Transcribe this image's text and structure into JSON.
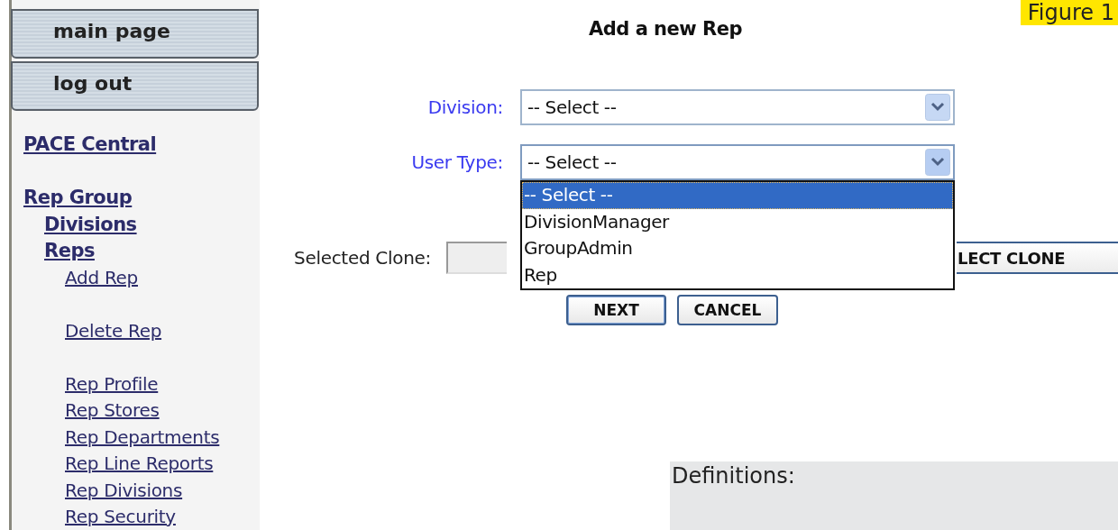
{
  "figure_label": "Figure 1",
  "sidebar": {
    "buttons": [
      "main page",
      "log out"
    ],
    "links": [
      {
        "label": "PACE Central"
      },
      {
        "label": "Rep Group",
        "children": [
          {
            "label": "Divisions"
          },
          {
            "label": "Reps",
            "sections": [
              {
                "links": [
                  {
                    "label": "Add Rep"
                  }
                ]
              },
              {
                "links": [
                  {
                    "label": "Delete Rep"
                  }
                ]
              },
              {
                "links": [
                  {
                    "label": "Rep Profile"
                  },
                  {
                    "label": "Rep Stores"
                  },
                  {
                    "label": "Rep Departments"
                  },
                  {
                    "label": "Rep Line Reports"
                  },
                  {
                    "label": "Rep Divisions"
                  },
                  {
                    "label": "Rep Security"
                  }
                ]
              }
            ]
          }
        ]
      }
    ]
  },
  "form": {
    "title": "Add a new Rep",
    "fields": [
      {
        "label": "Division:",
        "value": "-- Select --",
        "expanded": false
      },
      {
        "label": "User Type:",
        "value": "-- Select --",
        "expanded": true,
        "options": [
          {
            "label": "-- Select --",
            "selected": true
          },
          {
            "label": "DivisionManager",
            "selected": false
          },
          {
            "label": "GroupAdmin",
            "selected": false
          },
          {
            "label": "Rep",
            "selected": false
          }
        ]
      }
    ],
    "clone": {
      "label": "Selected Clone:",
      "button": "LECT CLONE"
    },
    "buttons": [
      "NEXT",
      "CANCEL"
    ]
  },
  "definitions": {
    "heading": "Definitions:"
  }
}
